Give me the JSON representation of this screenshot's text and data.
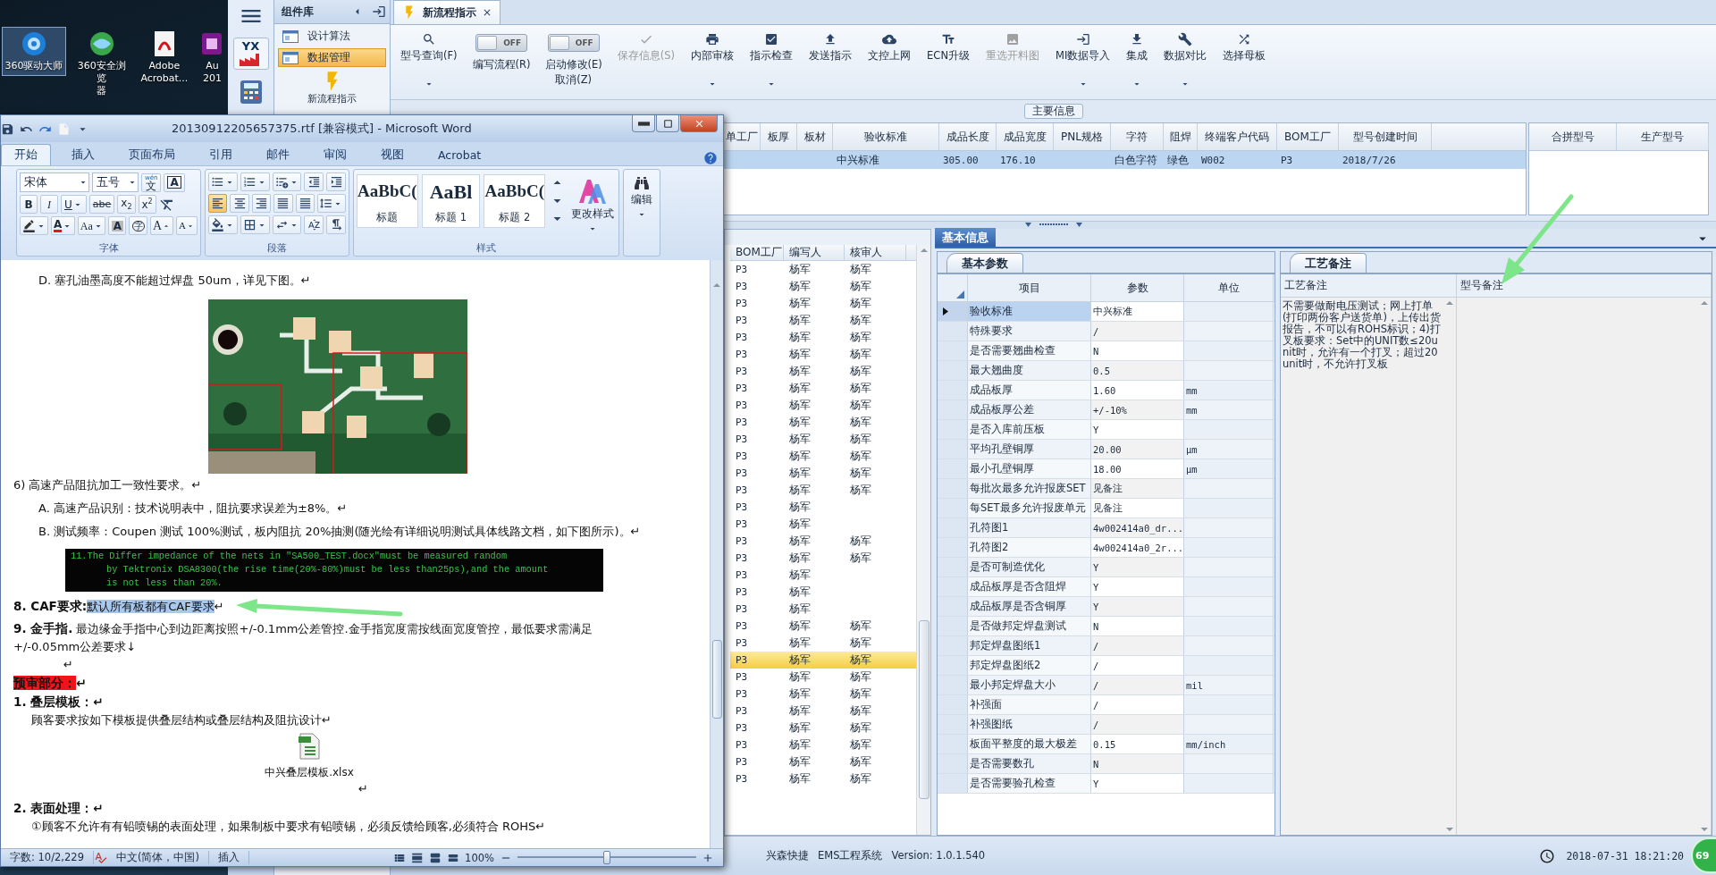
{
  "desktop_icons": [
    {
      "lines": [
        "360驱动大师"
      ],
      "selected": true
    },
    {
      "lines": [
        "360安全浏览",
        "器"
      ],
      "selected": false
    },
    {
      "lines": [
        "Adobe",
        "Acrobat..."
      ],
      "selected": false
    },
    {
      "lines": [
        "Au",
        "201"
      ],
      "selected": false
    }
  ],
  "nav": {
    "logo_text": "YX"
  },
  "component_panel": {
    "title": "组件库",
    "items": [
      {
        "label": "设计算法",
        "selected": false
      },
      {
        "label": "数据管理",
        "selected": true
      }
    ],
    "flow": "新流程指示"
  },
  "document_tab": {
    "label": "新流程指示"
  },
  "toolbar": [
    {
      "kind": "button",
      "label": "型号查询(F)",
      "dropdown": true,
      "disabled": false
    },
    {
      "kind": "toggle",
      "label": "编写流程(R)",
      "switch": "OFF",
      "on": false
    },
    {
      "kind": "toggle",
      "label": "启动修改(E)",
      "label2": "取消(Z)",
      "switch": "OFF",
      "on": false
    },
    {
      "kind": "button",
      "label": "保存信息(S)",
      "dropdown": false,
      "disabled": true
    },
    {
      "kind": "button",
      "label": "内部审核",
      "dropdown": true,
      "disabled": false
    },
    {
      "kind": "button",
      "label": "指示检查",
      "dropdown": true,
      "disabled": false
    },
    {
      "kind": "button",
      "label": "发送指示",
      "dropdown": false,
      "disabled": false
    },
    {
      "kind": "button",
      "label": "文控上网",
      "dropdown": false,
      "disabled": false
    },
    {
      "kind": "button",
      "label": "ECN升级",
      "dropdown": false,
      "disabled": false
    },
    {
      "kind": "button",
      "label": "重选开料图",
      "dropdown": false,
      "disabled": true
    },
    {
      "kind": "button",
      "label": "MI数据导入",
      "dropdown": true,
      "disabled": false
    },
    {
      "kind": "button",
      "label": "集成",
      "dropdown": true,
      "disabled": false
    },
    {
      "kind": "button",
      "label": "数据对比",
      "dropdown": true,
      "disabled": false
    },
    {
      "kind": "button",
      "label": "选择母板",
      "dropdown": false,
      "disabled": false
    }
  ],
  "main_info": {
    "title": "主要信息",
    "columns": [
      "单工厂",
      "板厚",
      "板材",
      "验收标准",
      "成品长度",
      "成品宽度",
      "PNL规格",
      "字符",
      "阻焊",
      "终端客户代码",
      "BOM工厂",
      "型号创建时间"
    ],
    "rows": [
      {
        "cells": [
          null,
          null,
          null,
          "中兴标准",
          "305.00",
          "176.10",
          null,
          "白色字符",
          "绿色",
          "W002",
          "P3",
          "2018/7/26"
        ],
        "selected": true
      }
    ],
    "side_columns": [
      "合拼型号",
      "生产型号"
    ]
  },
  "bom_list": {
    "columns": [
      "BOM工厂",
      "编写人",
      "核审人"
    ],
    "rows": [
      {
        "bom": "P3",
        "writer": "杨军",
        "reviewer": "杨军",
        "selected": false
      },
      {
        "bom": "P3",
        "writer": "杨军",
        "reviewer": "杨军",
        "selected": false
      },
      {
        "bom": "P3",
        "writer": "杨军",
        "reviewer": "杨军",
        "selected": false
      },
      {
        "bom": "P3",
        "writer": "杨军",
        "reviewer": "杨军",
        "selected": false
      },
      {
        "bom": "P3",
        "writer": "杨军",
        "reviewer": "杨军",
        "selected": false
      },
      {
        "bom": "P3",
        "writer": "杨军",
        "reviewer": "杨军",
        "selected": false
      },
      {
        "bom": "P3",
        "writer": "杨军",
        "reviewer": "杨军",
        "selected": false
      },
      {
        "bom": "P3",
        "writer": "杨军",
        "reviewer": "杨军",
        "selected": false
      },
      {
        "bom": "P3",
        "writer": "杨军",
        "reviewer": "杨军",
        "selected": false
      },
      {
        "bom": "P3",
        "writer": "杨军",
        "reviewer": "杨军",
        "selected": false
      },
      {
        "bom": "P3",
        "writer": "杨军",
        "reviewer": "杨军",
        "selected": false
      },
      {
        "bom": "P3",
        "writer": "杨军",
        "reviewer": "杨军",
        "selected": false
      },
      {
        "bom": "P3",
        "writer": "杨军",
        "reviewer": "杨军",
        "selected": false
      },
      {
        "bom": "P3",
        "writer": "杨军",
        "reviewer": "杨军",
        "selected": false
      },
      {
        "bom": "P3",
        "writer": "杨军",
        "selected": false
      },
      {
        "bom": "P3",
        "writer": "杨军",
        "selected": false
      },
      {
        "bom": "P3",
        "writer": "杨军",
        "reviewer": "杨军",
        "selected": false
      },
      {
        "bom": "P3",
        "writer": "杨军",
        "reviewer": "杨军",
        "selected": false
      },
      {
        "bom": "P3",
        "writer": "杨军",
        "selected": false
      },
      {
        "bom": "P3",
        "writer": "杨军",
        "selected": false
      },
      {
        "bom": "P3",
        "writer": "杨军",
        "selected": false
      },
      {
        "bom": "P3",
        "writer": "杨军",
        "reviewer": "杨军",
        "selected": false
      },
      {
        "bom": "P3",
        "writer": "杨军",
        "reviewer": "杨军",
        "selected": false
      },
      {
        "bom": "P3",
        "writer": "杨军",
        "reviewer": "杨军",
        "selected": true
      },
      {
        "bom": "P3",
        "writer": "杨军",
        "reviewer": "杨军",
        "selected": false
      },
      {
        "bom": "P3",
        "writer": "杨军",
        "reviewer": "杨军",
        "selected": false
      },
      {
        "bom": "P3",
        "writer": "杨军",
        "reviewer": "杨军",
        "selected": false
      },
      {
        "bom": "P3",
        "writer": "杨军",
        "reviewer": "杨军",
        "selected": false
      },
      {
        "bom": "P3",
        "writer": "杨军",
        "reviewer": "杨军",
        "selected": false
      },
      {
        "bom": "P3",
        "writer": "杨军",
        "reviewer": "杨军",
        "selected": false
      },
      {
        "bom": "P3",
        "writer": "杨军",
        "reviewer": "杨军",
        "selected": false
      }
    ]
  },
  "basic_info": {
    "title": "基本信息",
    "tab": "基本参数",
    "columns": [
      "项目",
      "参数",
      "单位"
    ],
    "rows": [
      {
        "item": "验收标准",
        "value": "中兴标准",
        "selected": true
      },
      {
        "item": "特殊要求",
        "value": "/",
        "selected": false
      },
      {
        "item": "是否需要翘曲检查",
        "value": "N",
        "selected": false
      },
      {
        "item": "最大翘曲度",
        "value": "0.5",
        "selected": false
      },
      {
        "item": "成品板厚",
        "value": "1.60",
        "unit": "mm",
        "selected": false
      },
      {
        "item": "成品板厚公差",
        "value": "+/-10%",
        "unit": "mm",
        "selected": false
      },
      {
        "item": "是否入库前压板",
        "value": "Y",
        "selected": false
      },
      {
        "item": "平均孔壁铜厚",
        "value": "20.00",
        "unit": "μm",
        "selected": false
      },
      {
        "item": "最小孔壁铜厚",
        "value": "18.00",
        "unit": "μm",
        "selected": false
      },
      {
        "item": "每批次最多允许报废SET",
        "value": "见备注",
        "selected": false
      },
      {
        "item": "每SET最多允许报废单元",
        "value": "见备注",
        "selected": false
      },
      {
        "item": "孔符图1",
        "value": "4w002414a0_dr...",
        "selected": false
      },
      {
        "item": "孔符图2",
        "value": "4w002414a0_2r...",
        "selected": false
      },
      {
        "item": "是否可制造优化",
        "value": "Y",
        "selected": false
      },
      {
        "item": "成品板厚是否含阻焊",
        "value": "Y",
        "selected": false
      },
      {
        "item": "成品板厚是否含铜厚",
        "value": "Y",
        "selected": false
      },
      {
        "item": "是否做邦定焊盘测试",
        "value": "N",
        "selected": false
      },
      {
        "item": "邦定焊盘图纸1",
        "value": "/",
        "selected": false
      },
      {
        "item": "邦定焊盘图纸2",
        "value": "/",
        "selected": false
      },
      {
        "item": "最小邦定焊盘大小",
        "value": "/",
        "unit": "mil",
        "selected": false
      },
      {
        "item": "补强面",
        "value": "/",
        "selected": false
      },
      {
        "item": "补强图纸",
        "value": "/",
        "selected": false
      },
      {
        "item": "板面平整度的最大极差",
        "value": "0.15",
        "unit": "mm/inch",
        "selected": false
      },
      {
        "item": "是否需要数孔",
        "value": "N",
        "selected": false
      },
      {
        "item": "是否需要验孔检查",
        "value": "Y",
        "selected": false
      }
    ]
  },
  "process_notes": {
    "tab": "工艺备注",
    "columns": [
      "工艺备注",
      "型号备注"
    ],
    "note": "不需要做耐电压测试；网上打单(打印两份客户送货单)，上传出货报告，不可以有ROHS标识；4)打叉板要求：Set中的UNIT数≤20unit时，允许有一个打叉；超过20unit时，不允许打叉板"
  },
  "status_bar": {
    "items": [
      "兴森快捷",
      "EMS工程系统",
      "Version: 1.0.1.540"
    ],
    "datetime": "2018-07-31 18:21:20"
  },
  "badge": "69",
  "word": {
    "title": "20130912205657375.rtf [兼容模式] - Microsoft Word",
    "tabs": [
      {
        "label": "开始",
        "selected": true
      },
      {
        "label": "插入",
        "selected": false
      },
      {
        "label": "页面布局",
        "selected": false
      },
      {
        "label": "引用",
        "selected": false
      },
      {
        "label": "邮件",
        "selected": false
      },
      {
        "label": "审阅",
        "selected": false
      },
      {
        "label": "视图",
        "selected": false
      },
      {
        "label": "Acrobat",
        "selected": false
      }
    ],
    "font_group": {
      "label": "字体",
      "font": "宋体",
      "size": "五号",
      "row1": [
        {
          "kind": "phonetic",
          "label": "文",
          "ruby": "wén"
        },
        {
          "kind": "border",
          "label": "A"
        }
      ],
      "row2": [
        {
          "kind": "bold",
          "label": "B"
        },
        {
          "kind": "italic",
          "label": "I"
        },
        {
          "kind": "underline",
          "label": "U",
          "caret": true
        },
        {
          "kind": "strike",
          "label": "abe"
        },
        {
          "kind": "sub",
          "label": "x",
          "script": "2"
        },
        {
          "kind": "sup",
          "label": "x",
          "script": "2"
        },
        {
          "kind": "clear"
        }
      ],
      "row3": [
        {
          "kind": "highlight",
          "caret": true
        },
        {
          "kind": "color",
          "label": "A",
          "caret": true
        },
        {
          "kind": "case",
          "label": "Aa",
          "caret": true
        },
        {
          "kind": "shade",
          "label": "A"
        },
        {
          "kind": "enclose",
          "label": "字"
        },
        {
          "kind": "grow",
          "label": "A"
        },
        {
          "kind": "shrink",
          "label": "A"
        }
      ]
    },
    "paragraph_group": {
      "label": "段落",
      "alignments": [
        {
          "selected": true
        },
        {
          "selected": false
        },
        {
          "selected": false
        },
        {
          "selected": false
        },
        {
          "selected": false
        }
      ]
    },
    "styles_group": {
      "label": "样式",
      "styles": [
        {
          "kind": "normal",
          "sample": "AaBbC(",
          "name": "标题"
        },
        {
          "kind": "heading1",
          "sample": "AaBl",
          "name": "标题 1"
        },
        {
          "kind": "heading2",
          "sample": "AaBbC(",
          "name": "标题 2"
        }
      ],
      "change": "更改样式"
    },
    "editing_group": {
      "label": "编辑"
    },
    "document": [
      {
        "kind": "item",
        "text": "D. 塞孔油墨高度不能超过焊盘 50um，详见下图。↵"
      },
      {
        "kind": "picture"
      },
      {
        "kind": "para",
        "text": "6) 高速产品阻抗加工一致性要求。↵"
      },
      {
        "kind": "item",
        "text": "A. 高速产品识别：技术说明表中，阻抗要求误差为±8%。↵"
      },
      {
        "kind": "item",
        "text": "B. 测试频率：Coupen 测试 100%测试，板内阻抗 20%抽测(随光绘有详细说明测试具体线路文档，如下图所示)。↵"
      },
      {
        "kind": "code",
        "lines": [
          "11.The Differ impedance of the nets in \"SA500_TEST.docx\"must be measured random",
          "by Tektronix DSA8300(the rise time(20%-80%)must be less than25ps),and the amount",
          "is not less than 20%."
        ]
      },
      {
        "kind": "lead",
        "lead": "8. CAF要求:",
        "text": "默认所有板都有CAF要求",
        "end": "↵",
        "selected": true
      },
      {
        "kind": "lead",
        "lead": "9. 金手指.",
        "text": " 最边缘金手指中心到边距离按照+/-0.1mm公差管控.金手指宽度需按线面宽度管控，最低要求需满足 +/-0.05mm公差要求↓",
        "selected": false
      },
      {
        "kind": "mark",
        "text": "↵"
      },
      {
        "kind": "alert",
        "text": "预审部分：",
        "end": "↵"
      },
      {
        "kind": "heading",
        "text": "1. 叠层模板：↵"
      },
      {
        "kind": "body",
        "text": "顾客要求按如下模板提供叠层结构或叠层结构及阻抗设计↵"
      },
      {
        "kind": "attachment",
        "text": "中兴叠层模板.xlsx"
      },
      {
        "kind": "center_mark",
        "text": "↵"
      },
      {
        "kind": "heading",
        "text": "2. 表面处理：↵"
      },
      {
        "kind": "body",
        "text": "①顾客不允许有有铅喷锡的表面处理，如果制板中要求有铅喷锡，必须反馈给顾客,必须符合 ROHS↵"
      }
    ],
    "status": {
      "words": "字数: 10/2,229",
      "language": "中文(简体，中国)",
      "mode": "插入",
      "zoom": "100%",
      "level": 0.5
    }
  }
}
